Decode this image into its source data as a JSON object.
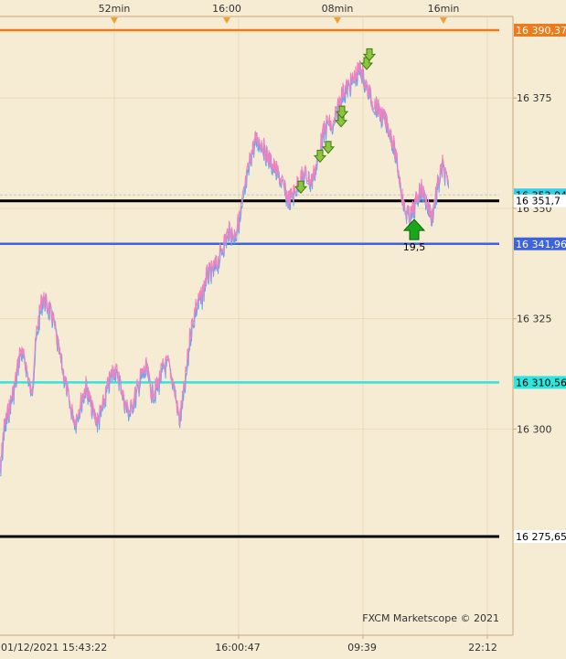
{
  "chart_data": {
    "type": "line",
    "title": "",
    "xlabel": "",
    "ylabel": "",
    "ylim": [
      16263,
      16400
    ],
    "y_ticks": [
      "16 375",
      "16 350",
      "16 325",
      "16 300"
    ],
    "top_axis_labels": [
      "52min",
      "16:00",
      "08min",
      "16min"
    ],
    "bottom_axis_labels": [
      "01/12/2021 15:43:22",
      "16:00:47",
      "09:39",
      "22:12"
    ],
    "horizontal_levels": [
      {
        "value": 16390.37,
        "label": "16 390,37",
        "color": "#f07a1a"
      },
      {
        "value": 16353.04,
        "label": "16 353,04",
        "color": "#c8c8c8"
      },
      {
        "value": 16351.7,
        "label": "16 351,7",
        "color": "#000000"
      },
      {
        "value": 16341.96,
        "label": "16 341,96",
        "color": "#3d63dd"
      },
      {
        "value": 16310.56,
        "label": "16 310,56",
        "color": "#2ee6e0"
      },
      {
        "value": 16275.65,
        "label": "16 275,65",
        "color": "#000000"
      }
    ],
    "series": [
      {
        "x": [
          0,
          4,
          10,
          16,
          22,
          28,
          34,
          40,
          46,
          52,
          58,
          64,
          70,
          76,
          82,
          88,
          94,
          100,
          106,
          112,
          118,
          124,
          130,
          136,
          142,
          148,
          154,
          160,
          166,
          172,
          178,
          184,
          190,
          196,
          202,
          208,
          214,
          220,
          226,
          232,
          238,
          244,
          250,
          256,
          262,
          268,
          274,
          280,
          286,
          292,
          298,
          304,
          310,
          316,
          322,
          328,
          334,
          340,
          346,
          352,
          358,
          364,
          370,
          376,
          382,
          388,
          394,
          400,
          406,
          412,
          418,
          424,
          430,
          436,
          442,
          448,
          454,
          460,
          466,
          472,
          478,
          484,
          490
        ],
        "values": [
          16290,
          16300,
          16305,
          16310,
          16318,
          16315,
          16308,
          16322,
          16330,
          16328,
          16325,
          16318,
          16312,
          16306,
          16302,
          16306,
          16310,
          16305,
          16302,
          16305,
          16310,
          16314,
          16312,
          16306,
          16304,
          16308,
          16312,
          16314,
          16308,
          16310,
          16314,
          16315,
          16310,
          16302,
          16310,
          16322,
          16328,
          16330,
          16335,
          16336,
          16338,
          16342,
          16345,
          16344,
          16348,
          16355,
          16362,
          16366,
          16365,
          16362,
          16360,
          16358,
          16355,
          16352,
          16354,
          16357,
          16358,
          16356,
          16360,
          16366,
          16370,
          16368,
          16374,
          16377,
          16378,
          16380,
          16382,
          16378,
          16375,
          16373,
          16371,
          16369,
          16365,
          16358,
          16350,
          16348,
          16351,
          16355,
          16352,
          16348,
          16355,
          16360,
          16355
        ]
      }
    ],
    "trade_markers": [
      {
        "x": 329,
        "value": 16354.5,
        "kind": "sell"
      },
      {
        "x": 350,
        "value": 16361.5,
        "kind": "sell"
      },
      {
        "x": 359,
        "value": 16363.5,
        "kind": "sell"
      },
      {
        "x": 373,
        "value": 16369.5,
        "kind": "sell"
      },
      {
        "x": 374,
        "value": 16371.5,
        "kind": "sell"
      },
      {
        "x": 401,
        "value": 16382.5,
        "kind": "sell"
      },
      {
        "x": 404,
        "value": 16384.5,
        "kind": "sell"
      },
      {
        "x": 453,
        "value": 16345,
        "kind": "buy",
        "label": "19,5"
      }
    ],
    "watermark": "FXCM Marketscope © 2021"
  }
}
